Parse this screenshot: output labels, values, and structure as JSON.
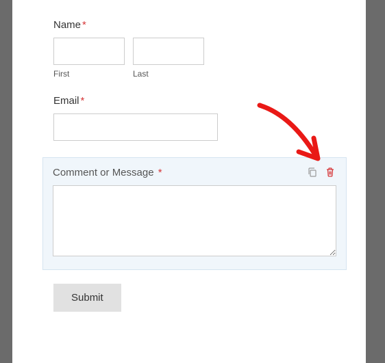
{
  "fields": {
    "name": {
      "label": "Name",
      "first_sublabel": "First",
      "last_sublabel": "Last",
      "required": true
    },
    "email": {
      "label": "Email",
      "required": true
    },
    "comment": {
      "label": "Comment or Message",
      "required": true
    }
  },
  "actions": {
    "duplicate_title": "Duplicate",
    "delete_title": "Delete"
  },
  "submit": {
    "label": "Submit"
  },
  "colors": {
    "required": "#d63638",
    "highlight_bg": "#f0f6fb",
    "delete_icon": "#d63638",
    "arrow": "#e91916"
  }
}
